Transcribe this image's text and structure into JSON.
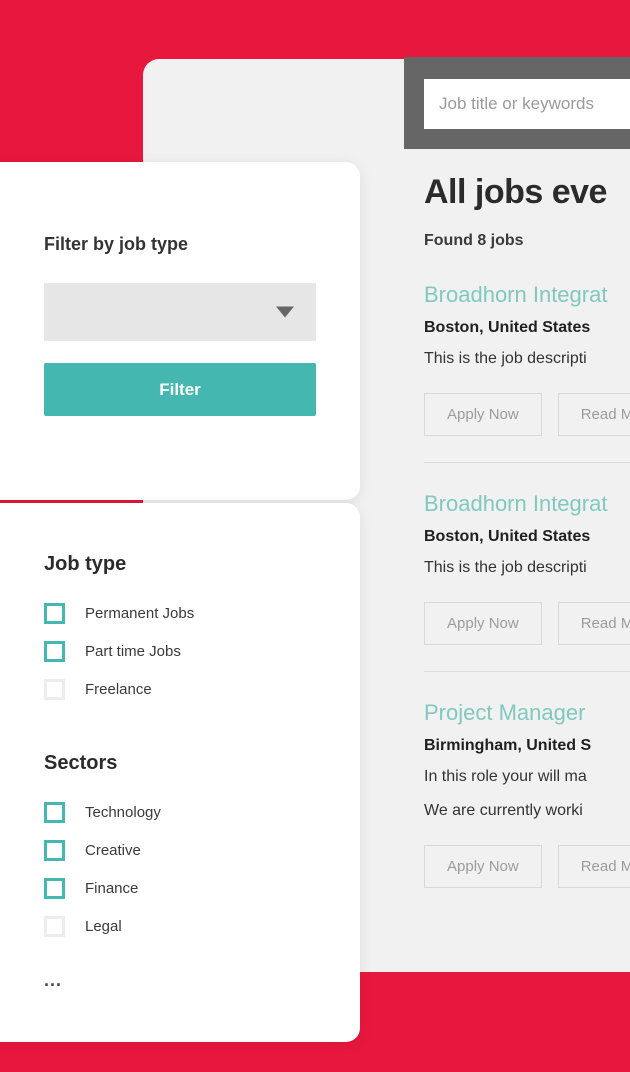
{
  "theme": {
    "background_red": "#E8173D",
    "panel_grey": "#F1F1F1",
    "accent_teal": "#44B8B0",
    "job_title_teal": "#7FC9BF",
    "search_frame_grey": "#666666"
  },
  "search": {
    "placeholder": "Job title or keywords",
    "value": ""
  },
  "main": {
    "title": "All jobs eve",
    "found_label": "Found 8 jobs",
    "jobs": [
      {
        "title": "Broadhorn Integrat",
        "location": "Boston, United States",
        "description": [
          "This is the job descripti"
        ],
        "apply_label": "Apply Now",
        "read_more_label": "Read M"
      },
      {
        "title": "Broadhorn Integrat",
        "location": "Boston, United States",
        "description": [
          "This is the job descripti"
        ],
        "apply_label": "Apply Now",
        "read_more_label": "Read M"
      },
      {
        "title": "Project Manager",
        "location": "Birmingham, United S",
        "description": [
          "In this role your will ma",
          "We are currently worki"
        ],
        "apply_label": "Apply Now",
        "read_more_label": "Read M"
      }
    ]
  },
  "filter_card": {
    "heading": "Filter by job type",
    "select_value": "",
    "button_label": "Filter"
  },
  "facets": {
    "more_label": "...",
    "groups": [
      {
        "heading": "Job type",
        "options": [
          {
            "label": "Permanent Jobs",
            "checked": true
          },
          {
            "label": "Part time Jobs",
            "checked": true
          },
          {
            "label": "Freelance",
            "checked": false
          }
        ]
      },
      {
        "heading": "Sectors",
        "options": [
          {
            "label": "Technology",
            "checked": true
          },
          {
            "label": "Creative",
            "checked": true
          },
          {
            "label": "Finance",
            "checked": true
          },
          {
            "label": "Legal",
            "checked": false
          }
        ]
      }
    ]
  }
}
